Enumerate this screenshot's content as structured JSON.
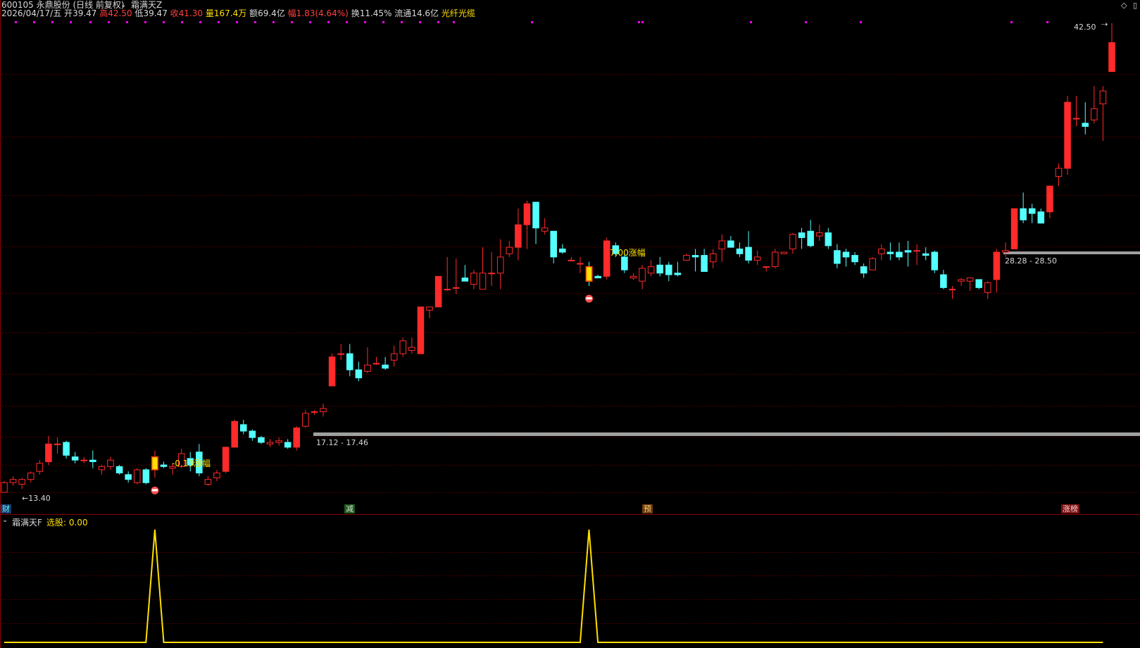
{
  "header": {
    "stock_code_name": "600105 永鼎股份 (日线 前复权)",
    "indicator_name": "霜满天Z",
    "date": "2026/04/17/五",
    "open_label": "开",
    "open_value": "39.47",
    "high_label": "高",
    "high_value": "42.50",
    "low_label": "低",
    "low_value": "39.47",
    "close_label": "收",
    "close_value": "41.30",
    "volume_label": "量",
    "volume_value": "167.4万",
    "amount_label": "额",
    "amount_value": "69.4亿",
    "change_label": "幅",
    "change_value": "1.83(4.64%)",
    "turnover_label": "换",
    "turnover_value": "11.45%",
    "float_label": "流通",
    "float_value": "14.6亿",
    "concept": "光纤光缆"
  },
  "annotations": {
    "low_price": "←13.40",
    "high_price": "42.50",
    "box1_range": "17.12 - 17.46",
    "box2_range": "28.28 - 28.50",
    "change1": "-0.13涨幅",
    "change2": "7.00涨幅"
  },
  "event_tags": {
    "cai": "财",
    "jian": "减",
    "yu": "预",
    "zhangting": "涨榜"
  },
  "sub_panel": {
    "indicator_name": "霜满天F",
    "select_label": "选股: 0.00"
  },
  "colors": {
    "up": "#ff2a2a",
    "down": "#54ffff",
    "grid": "#8b0000",
    "signal": "#ffe000",
    "box": "#a0a0a0",
    "bg": "#000000"
  },
  "chart_data": {
    "type": "candlestick",
    "price_range": [
      13.4,
      42.5
    ],
    "candles": [
      [
        13.4,
        14.1,
        13.4,
        14.0
      ],
      [
        14.0,
        14.4,
        13.8,
        14.2
      ],
      [
        13.9,
        14.3,
        13.6,
        14.2
      ],
      [
        14.2,
        14.7,
        14.0,
        14.6
      ],
      [
        14.7,
        15.4,
        14.5,
        15.2
      ],
      [
        15.3,
        16.9,
        15.1,
        16.4
      ],
      [
        16.4,
        16.8,
        15.8,
        16.4
      ],
      [
        16.5,
        16.6,
        15.5,
        15.7
      ],
      [
        15.6,
        15.9,
        15.2,
        15.4
      ],
      [
        15.4,
        15.6,
        15.2,
        15.4
      ],
      [
        15.4,
        16.0,
        14.9,
        15.3
      ],
      [
        14.8,
        15.1,
        14.5,
        15.0
      ],
      [
        15.0,
        15.6,
        14.8,
        15.4
      ],
      [
        15.0,
        15.1,
        14.5,
        14.6
      ],
      [
        14.5,
        14.7,
        14.0,
        14.2
      ],
      [
        14.0,
        14.9,
        13.9,
        14.8
      ],
      [
        14.8,
        14.9,
        13.9,
        14.0
      ],
      [
        14.8,
        16.0,
        14.3,
        15.6
      ],
      [
        15.1,
        15.3,
        14.9,
        15.0
      ],
      [
        14.9,
        15.2,
        14.5,
        15.0
      ],
      [
        15.0,
        16.1,
        14.9,
        15.8
      ],
      [
        15.5,
        15.9,
        14.7,
        15.1
      ],
      [
        15.9,
        16.4,
        14.4,
        14.6
      ],
      [
        13.9,
        14.4,
        13.8,
        14.2
      ],
      [
        14.3,
        14.8,
        14.1,
        14.6
      ],
      [
        14.7,
        16.2,
        14.6,
        16.2
      ],
      [
        16.2,
        17.9,
        16.2,
        17.8
      ],
      [
        17.6,
        17.9,
        17.0,
        17.2
      ],
      [
        17.2,
        17.3,
        16.6,
        16.8
      ],
      [
        16.8,
        16.9,
        16.4,
        16.5
      ],
      [
        16.4,
        16.7,
        16.2,
        16.5
      ],
      [
        16.5,
        16.8,
        16.3,
        16.6
      ],
      [
        16.5,
        16.7,
        16.1,
        16.2
      ],
      [
        16.2,
        17.5,
        16.0,
        17.4
      ],
      [
        17.5,
        18.5,
        17.4,
        18.3
      ],
      [
        18.4,
        18.5,
        18.2,
        18.4
      ],
      [
        18.4,
        18.9,
        18.1,
        18.6
      ],
      [
        20.0,
        22.0,
        20.0,
        21.8
      ],
      [
        22.0,
        22.6,
        21.6,
        22.0
      ],
      [
        22.0,
        22.6,
        20.6,
        21.0
      ],
      [
        21.0,
        21.5,
        20.3,
        20.5
      ],
      [
        20.9,
        22.4,
        20.8,
        21.3
      ],
      [
        21.4,
        21.8,
        21.3,
        21.4
      ],
      [
        21.3,
        21.8,
        21.0,
        21.1
      ],
      [
        21.6,
        22.5,
        21.2,
        22.0
      ],
      [
        22.0,
        23.0,
        21.8,
        22.8
      ],
      [
        22.2,
        23.0,
        22.0,
        22.4
      ],
      [
        22.0,
        24.8,
        22.0,
        24.9
      ],
      [
        24.7,
        24.8,
        24.2,
        24.9
      ],
      [
        24.9,
        26.2,
        24.9,
        26.8
      ],
      [
        26.0,
        28.0,
        25.9,
        26.0
      ],
      [
        26.1,
        27.9,
        25.7,
        26.1
      ],
      [
        26.7,
        27.5,
        26.5,
        26.5
      ],
      [
        26.3,
        27.2,
        26.0,
        27.0
      ],
      [
        26.0,
        28.6,
        26.0,
        27.0
      ],
      [
        27.0,
        28.3,
        26.2,
        27.0
      ],
      [
        27.0,
        29.1,
        26.0,
        28.0
      ],
      [
        28.2,
        29.0,
        28.0,
        28.6
      ],
      [
        28.6,
        31.0,
        27.8,
        30.0
      ],
      [
        30.0,
        31.5,
        28.5,
        31.3
      ],
      [
        31.4,
        31.4,
        28.8,
        29.8
      ],
      [
        29.6,
        30.4,
        29.4,
        29.8
      ],
      [
        29.6,
        29.6,
        27.6,
        28.0
      ],
      [
        28.5,
        28.8,
        28.2,
        28.3
      ],
      [
        27.8,
        28.0,
        27.8,
        27.8
      ],
      [
        27.6,
        28.0,
        27.0,
        27.6
      ],
      [
        27.4,
        27.7,
        26.2,
        26.5
      ],
      [
        26.8,
        26.9,
        26.7,
        26.7
      ],
      [
        26.8,
        29.2,
        26.6,
        29.0
      ],
      [
        28.7,
        28.9,
        28.0,
        28.2
      ],
      [
        28.0,
        28.2,
        27.0,
        27.2
      ],
      [
        26.7,
        27.0,
        26.6,
        26.8
      ],
      [
        26.5,
        27.5,
        26.0,
        27.3
      ],
      [
        27.0,
        27.8,
        26.8,
        27.4
      ],
      [
        27.5,
        28.0,
        26.8,
        27.0
      ],
      [
        27.5,
        27.7,
        26.5,
        26.9
      ],
      [
        27.0,
        27.7,
        26.8,
        26.9
      ],
      [
        27.8,
        28.2,
        27.8,
        28.1
      ],
      [
        28.1,
        28.5,
        27.1,
        28.0
      ],
      [
        28.1,
        28.5,
        27.1,
        27.1
      ],
      [
        27.7,
        28.5,
        27.3,
        28.2
      ],
      [
        28.5,
        29.4,
        27.7,
        29.0
      ],
      [
        29.0,
        29.3,
        28.6,
        28.6
      ],
      [
        28.5,
        28.9,
        28.0,
        28.2
      ],
      [
        28.6,
        29.6,
        27.6,
        27.8
      ],
      [
        27.8,
        28.4,
        27.5,
        28.0
      ],
      [
        27.4,
        27.4,
        27.1,
        27.4
      ],
      [
        27.4,
        28.5,
        27.3,
        28.3
      ],
      [
        28.2,
        28.3,
        28.3,
        28.3
      ],
      [
        28.5,
        29.5,
        28.2,
        29.4
      ],
      [
        29.5,
        29.8,
        28.5,
        29.2
      ],
      [
        29.6,
        30.3,
        28.6,
        28.7
      ],
      [
        29.3,
        30.0,
        29.0,
        29.5
      ],
      [
        29.5,
        29.8,
        28.5,
        28.7
      ],
      [
        28.4,
        28.8,
        27.3,
        27.6
      ],
      [
        28.3,
        28.5,
        27.4,
        28.0
      ],
      [
        28.1,
        28.3,
        27.5,
        27.7
      ],
      [
        27.4,
        27.6,
        26.7,
        27.0
      ],
      [
        27.2,
        28.0,
        27.2,
        27.9
      ],
      [
        28.2,
        28.8,
        27.8,
        28.5
      ],
      [
        28.3,
        28.9,
        27.8,
        28.2
      ],
      [
        28.3,
        28.9,
        27.8,
        28.0
      ],
      [
        28.4,
        29.0,
        27.4,
        28.3
      ],
      [
        28.4,
        28.8,
        27.5,
        28.4
      ],
      [
        28.2,
        28.6,
        27.8,
        28.1
      ],
      [
        28.3,
        28.4,
        27.0,
        27.2
      ],
      [
        26.9,
        27.2,
        26.0,
        26.1
      ],
      [
        26.0,
        26.2,
        25.4,
        26.0
      ],
      [
        26.5,
        26.7,
        26.2,
        26.6
      ],
      [
        26.5,
        26.7,
        25.9,
        26.7
      ],
      [
        26.6,
        26.6,
        26.0,
        26.1
      ],
      [
        25.8,
        26.5,
        25.4,
        26.4
      ],
      [
        26.6,
        28.5,
        25.8,
        28.3
      ],
      [
        28.3,
        28.9,
        28.0,
        28.4
      ],
      [
        28.5,
        31.0,
        28.5,
        31.0
      ],
      [
        31.0,
        32.0,
        30.1,
        30.3
      ],
      [
        31.0,
        31.3,
        30.1,
        30.7
      ],
      [
        30.8,
        31.0,
        30.1,
        30.1
      ],
      [
        30.8,
        32.3,
        30.4,
        32.4
      ],
      [
        33.0,
        33.8,
        32.4,
        33.5
      ],
      [
        33.5,
        38.0,
        33.1,
        37.6
      ],
      [
        36.6,
        38.0,
        36.1,
        36.6
      ],
      [
        36.3,
        37.6,
        35.6,
        36.1
      ],
      [
        36.5,
        38.6,
        36.3,
        37.2
      ],
      [
        37.5,
        38.6,
        35.2,
        38.3
      ],
      [
        39.5,
        42.5,
        39.5,
        41.3
      ]
    ],
    "signal_series": [
      0,
      0,
      0,
      0,
      0,
      0,
      0,
      0,
      0,
      0,
      0,
      0,
      0,
      0,
      0,
      0,
      0,
      1,
      0,
      0,
      0,
      0,
      0,
      0,
      0,
      0,
      0,
      0,
      0,
      0,
      0,
      0,
      0,
      0,
      0,
      0,
      0,
      0,
      0,
      0,
      0,
      0,
      0,
      0,
      0,
      0,
      0,
      0,
      0,
      0,
      0,
      0,
      0,
      0,
      0,
      0,
      0,
      0,
      0,
      0,
      0,
      0,
      0,
      0,
      0,
      0,
      1,
      0,
      0,
      0,
      0,
      0,
      0,
      0,
      0,
      0,
      0,
      0,
      0,
      0,
      0,
      0,
      0,
      0,
      0,
      0,
      0,
      0,
      0,
      0,
      0,
      0,
      0,
      0,
      0,
      0,
      0,
      0,
      0,
      0,
      0,
      0,
      0,
      0,
      0,
      0,
      0,
      0,
      0,
      0,
      0,
      0,
      0,
      0,
      0,
      0,
      0,
      0,
      0,
      0,
      0,
      0,
      0,
      0,
      0
    ]
  }
}
